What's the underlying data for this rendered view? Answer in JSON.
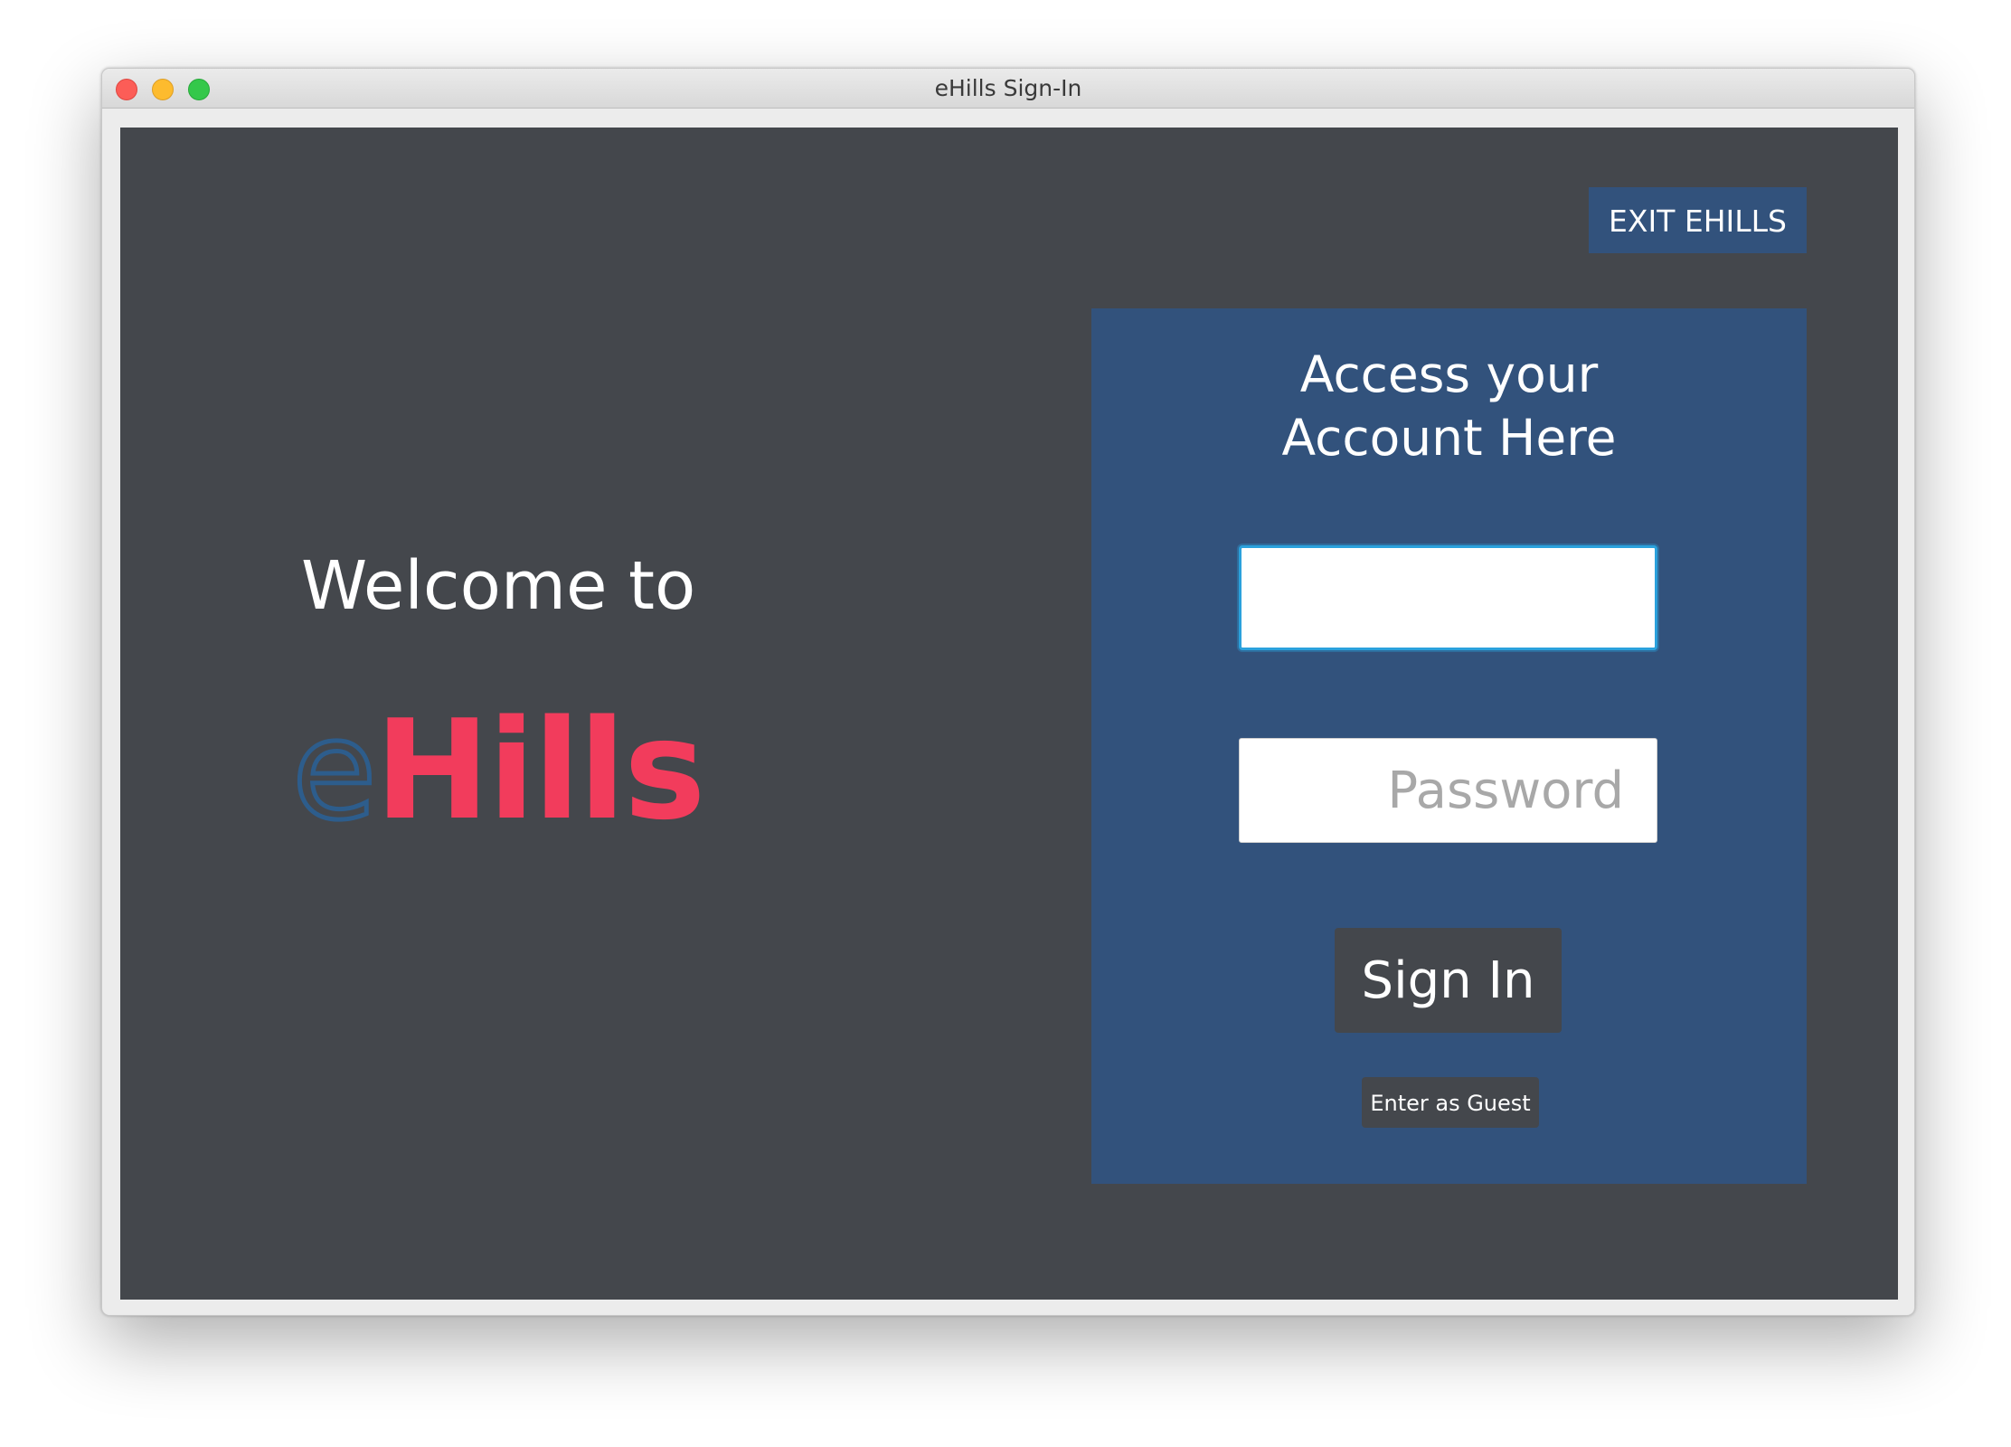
{
  "window": {
    "title": "eHills Sign-In"
  },
  "header": {
    "exit_label": "EXIT EHILLS"
  },
  "welcome": {
    "text": "Welcome to",
    "logo_e": "e",
    "logo_hills": "Hills"
  },
  "login": {
    "title": "Access your\nAccount Here",
    "username_value": "",
    "password_placeholder": "Password",
    "sign_in_label": "Sign In",
    "guest_label": "Enter as Guest"
  },
  "colors": {
    "background": "#44474c",
    "panel": "#32527c",
    "logo_e": "#2d5d8c",
    "logo_hills": "#f23c5c",
    "focus_ring": "#2ba1dc"
  }
}
